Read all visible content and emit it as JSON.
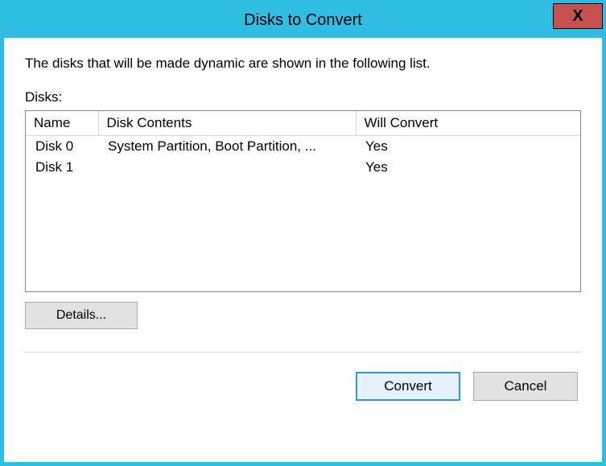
{
  "window": {
    "title": "Disks to Convert",
    "close_glyph": "X"
  },
  "description": "The disks that will be made dynamic are shown in the following list.",
  "disks_label": "Disks:",
  "columns": {
    "name": "Name",
    "contents": "Disk Contents",
    "convert": "Will Convert"
  },
  "rows": [
    {
      "name": "Disk 0",
      "contents": "System Partition, Boot Partition, ...",
      "convert": "Yes"
    },
    {
      "name": "Disk 1",
      "contents": "",
      "convert": "Yes"
    }
  ],
  "buttons": {
    "details": "Details...",
    "convert": "Convert",
    "cancel": "Cancel"
  }
}
